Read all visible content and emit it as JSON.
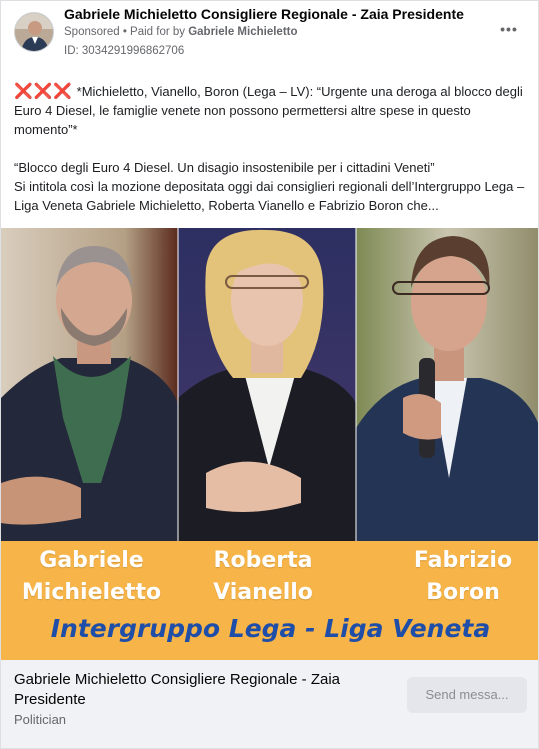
{
  "post": {
    "page_name": "Gabriele Michieletto Consigliere Regionale - Zaia Presidente",
    "sponsored_label": "Sponsored",
    "paid_for_prefix": " • Paid for by ",
    "payer": "Gabriele Michieletto",
    "library_id": "ID: 3034291996862706",
    "more_icon": "more-horizontal-icon",
    "text": {
      "marks": "❌❌❌",
      "line1": " *Michieletto, Vianello, Boron (Lega – LV): “Urgente una deroga al blocco degli Euro 4 Diesel, le famiglie venete non possono permettersi altre spese in questo momento”*",
      "line2": "“Blocco degli Euro 4 Diesel. Un disagio insostenibile per i cittadini Veneti”",
      "line3": "Si intitola così la mozione depositata oggi dai consiglieri regionali dell’Intergruppo Lega – Liga Veneta Gabriele Michieletto, Roberta Vianello e Fabrizio Boron che..."
    }
  },
  "creative": {
    "names": [
      {
        "first": "Gabriele",
        "last": "Michieletto"
      },
      {
        "first": "Roberta",
        "last": "Vianello"
      },
      {
        "first": "Fabrizio",
        "last": "Boron"
      }
    ],
    "tagline": "Intergruppo Lega - Liga Veneta",
    "colors": {
      "banner": "#f7b448",
      "tagline": "#1f4ea8",
      "names": "#ffffff"
    }
  },
  "footer": {
    "title": "Gabriele Michieletto Consigliere Regionale - Zaia Presidente",
    "category": "Politician",
    "cta": "Send messa..."
  }
}
